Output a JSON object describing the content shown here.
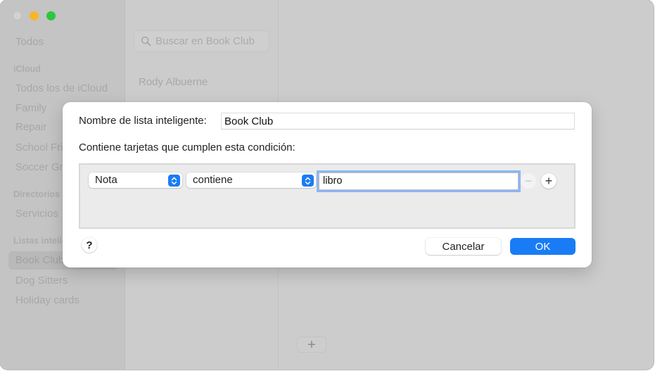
{
  "window": {
    "traffic_lights": [
      "close",
      "minimize",
      "maximize"
    ]
  },
  "sidebar": {
    "top_item": "Todos",
    "sections": [
      {
        "title": "iCloud",
        "items": [
          "Todos los de iCloud",
          "Family",
          "Repair",
          "School Friends",
          "Soccer Group"
        ]
      },
      {
        "title": "Directorios",
        "items": [
          "Servicios"
        ]
      },
      {
        "title": "Listas inteligentes",
        "items": [
          "Book Club",
          "Dog Sitters",
          "Holiday cards"
        ]
      }
    ],
    "selected": "Book Club"
  },
  "list": {
    "search_placeholder": "Buscar en Book Club",
    "contacts": [
      "Rody Albuerne"
    ]
  },
  "detail": {
    "add_button": "+"
  },
  "dialog": {
    "name_label": "Nombre de lista inteligente:",
    "name_value": "Book Club",
    "condition_label": "Contiene tarjetas que cumplen esta condición:",
    "rule": {
      "field": "Nota",
      "operator": "contiene",
      "value": "libro",
      "remove_label": "−",
      "add_label": "+"
    },
    "help_label": "?",
    "cancel_label": "Cancelar",
    "ok_label": "OK"
  },
  "colors": {
    "accent": "#1a7cf5",
    "traffic_close": "#d2d2d2",
    "traffic_minimize": "#f7b52a",
    "traffic_maximize": "#2cc73c"
  }
}
